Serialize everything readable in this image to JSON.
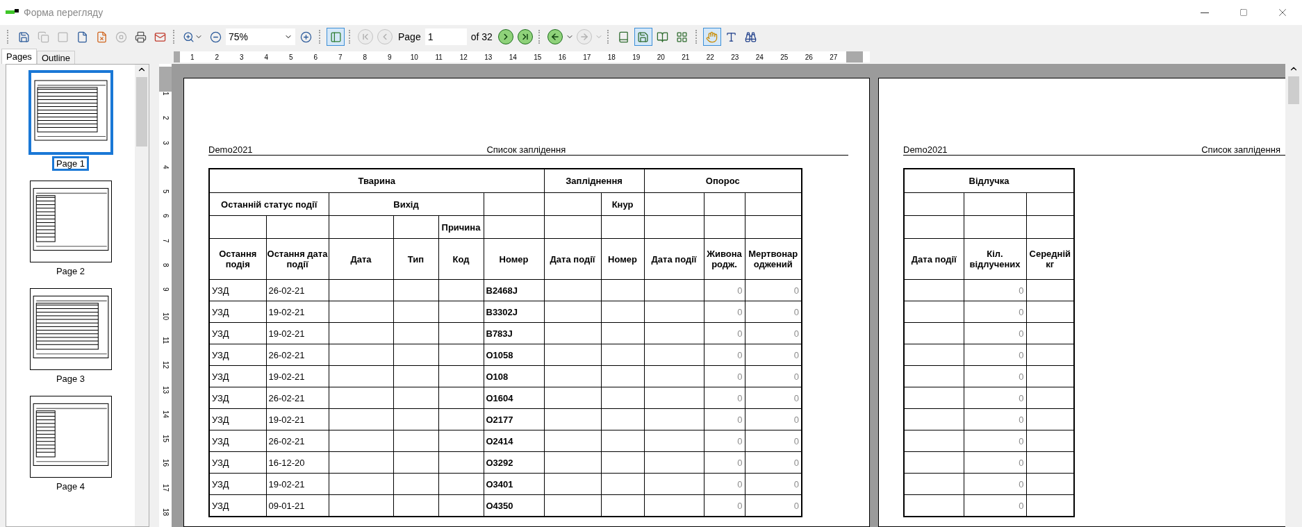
{
  "window": {
    "title": "Форма перегляду"
  },
  "toolbar": {
    "zoom": "75%",
    "page_label": "Page",
    "page": "1",
    "page_count": "of 32",
    "sidebar_toggle_on": true,
    "navigation": [
      {
        "kind": "first",
        "disabled": true
      },
      {
        "kind": "prev",
        "disabled": true
      },
      {
        "kind": "next",
        "disabled": false
      },
      {
        "kind": "last",
        "disabled": false
      }
    ],
    "history": [
      {
        "kind": "back",
        "disabled": false
      },
      {
        "kind": "forward",
        "disabled": true
      }
    ],
    "view_modes": [
      {
        "kind": "single",
        "selected": false
      },
      {
        "kind": "continuous",
        "selected": true
      },
      {
        "kind": "two_page",
        "selected": false
      },
      {
        "kind": "multi",
        "selected": false
      }
    ],
    "tools": [
      {
        "kind": "hand",
        "selected": true
      },
      {
        "kind": "text",
        "selected": false
      }
    ]
  },
  "side_tabs": [
    {
      "label": "Pages",
      "selected": true
    },
    {
      "label": "Outline",
      "selected": false
    }
  ],
  "thumbnails": [
    {
      "label": "Page 1",
      "selected": true,
      "kind": "wide"
    },
    {
      "label": "Page 2",
      "selected": false,
      "kind": "narrow"
    },
    {
      "label": "Page 3",
      "selected": false,
      "kind": "wide"
    },
    {
      "label": "Page 4",
      "selected": false,
      "kind": "narrow"
    }
  ],
  "horizontal_ruler": [
    "1",
    "2",
    "3",
    "4",
    "5",
    "6",
    "7",
    "8",
    "9",
    "10",
    "11",
    "12",
    "13",
    "14",
    "15",
    "16",
    "17",
    "18",
    "19",
    "20",
    "21",
    "22",
    "23",
    "24",
    "25",
    "26",
    "27"
  ],
  "vertical_ruler": [
    "1",
    "2",
    "3",
    "4",
    "5",
    "6",
    "7",
    "8",
    "9",
    "10",
    "11",
    "12",
    "13",
    "14",
    "15",
    "16",
    "17",
    "18"
  ],
  "pages": [
    {
      "header_left": "Demo2021",
      "header_title": "Список заплідення",
      "table": {
        "kind": "main",
        "headers": [
          "Тварина",
          "Запліднення",
          "Опорос",
          "Останній статус події",
          "Вихід",
          "Кнур",
          "Причина",
          "Остання подія",
          "Остання дата події",
          "Дата",
          "Тип",
          "Код",
          "Номер",
          "Дата події",
          "Номер",
          "Дата події",
          "Живонародж.",
          "Мертвонароджений"
        ],
        "rows": [
          {
            "event": "УЗД",
            "date": "26-02-21",
            "number": "B2468J",
            "live": "0",
            "dead": "0"
          },
          {
            "event": "УЗД",
            "date": "19-02-21",
            "number": "B3302J",
            "live": "0",
            "dead": "0"
          },
          {
            "event": "УЗД",
            "date": "19-02-21",
            "number": "B783J",
            "live": "0",
            "dead": "0"
          },
          {
            "event": "УЗД",
            "date": "26-02-21",
            "number": "O1058",
            "live": "0",
            "dead": "0"
          },
          {
            "event": "УЗД",
            "date": "19-02-21",
            "number": "O108",
            "live": "0",
            "dead": "0"
          },
          {
            "event": "УЗД",
            "date": "26-02-21",
            "number": "O1604",
            "live": "0",
            "dead": "0"
          },
          {
            "event": "УЗД",
            "date": "19-02-21",
            "number": "O2177",
            "live": "0",
            "dead": "0"
          },
          {
            "event": "УЗД",
            "date": "26-02-21",
            "number": "O2414",
            "live": "0",
            "dead": "0"
          },
          {
            "event": "УЗД",
            "date": "16-12-20",
            "number": "O3292",
            "live": "0",
            "dead": "0"
          },
          {
            "event": "УЗД",
            "date": "19-02-21",
            "number": "O3401",
            "live": "0",
            "dead": "0"
          },
          {
            "event": "УЗД",
            "date": "09-01-21",
            "number": "O4350",
            "live": "0",
            "dead": "0"
          }
        ]
      }
    },
    {
      "header_left": "Demo2021",
      "header_title": "Список заплідення",
      "table": {
        "kind": "weaning",
        "headers": [
          "Відлучка",
          "Дата події",
          "Кіл. відлучених",
          "Середній кг"
        ],
        "rows": [
          {
            "weaned": "0"
          },
          {
            "weaned": "0"
          },
          {
            "weaned": "0"
          },
          {
            "weaned": "0"
          },
          {
            "weaned": "0"
          },
          {
            "weaned": "0"
          },
          {
            "weaned": "0"
          },
          {
            "weaned": "0"
          },
          {
            "weaned": "0"
          },
          {
            "weaned": "0"
          },
          {
            "weaned": "0"
          }
        ]
      }
    }
  ]
}
